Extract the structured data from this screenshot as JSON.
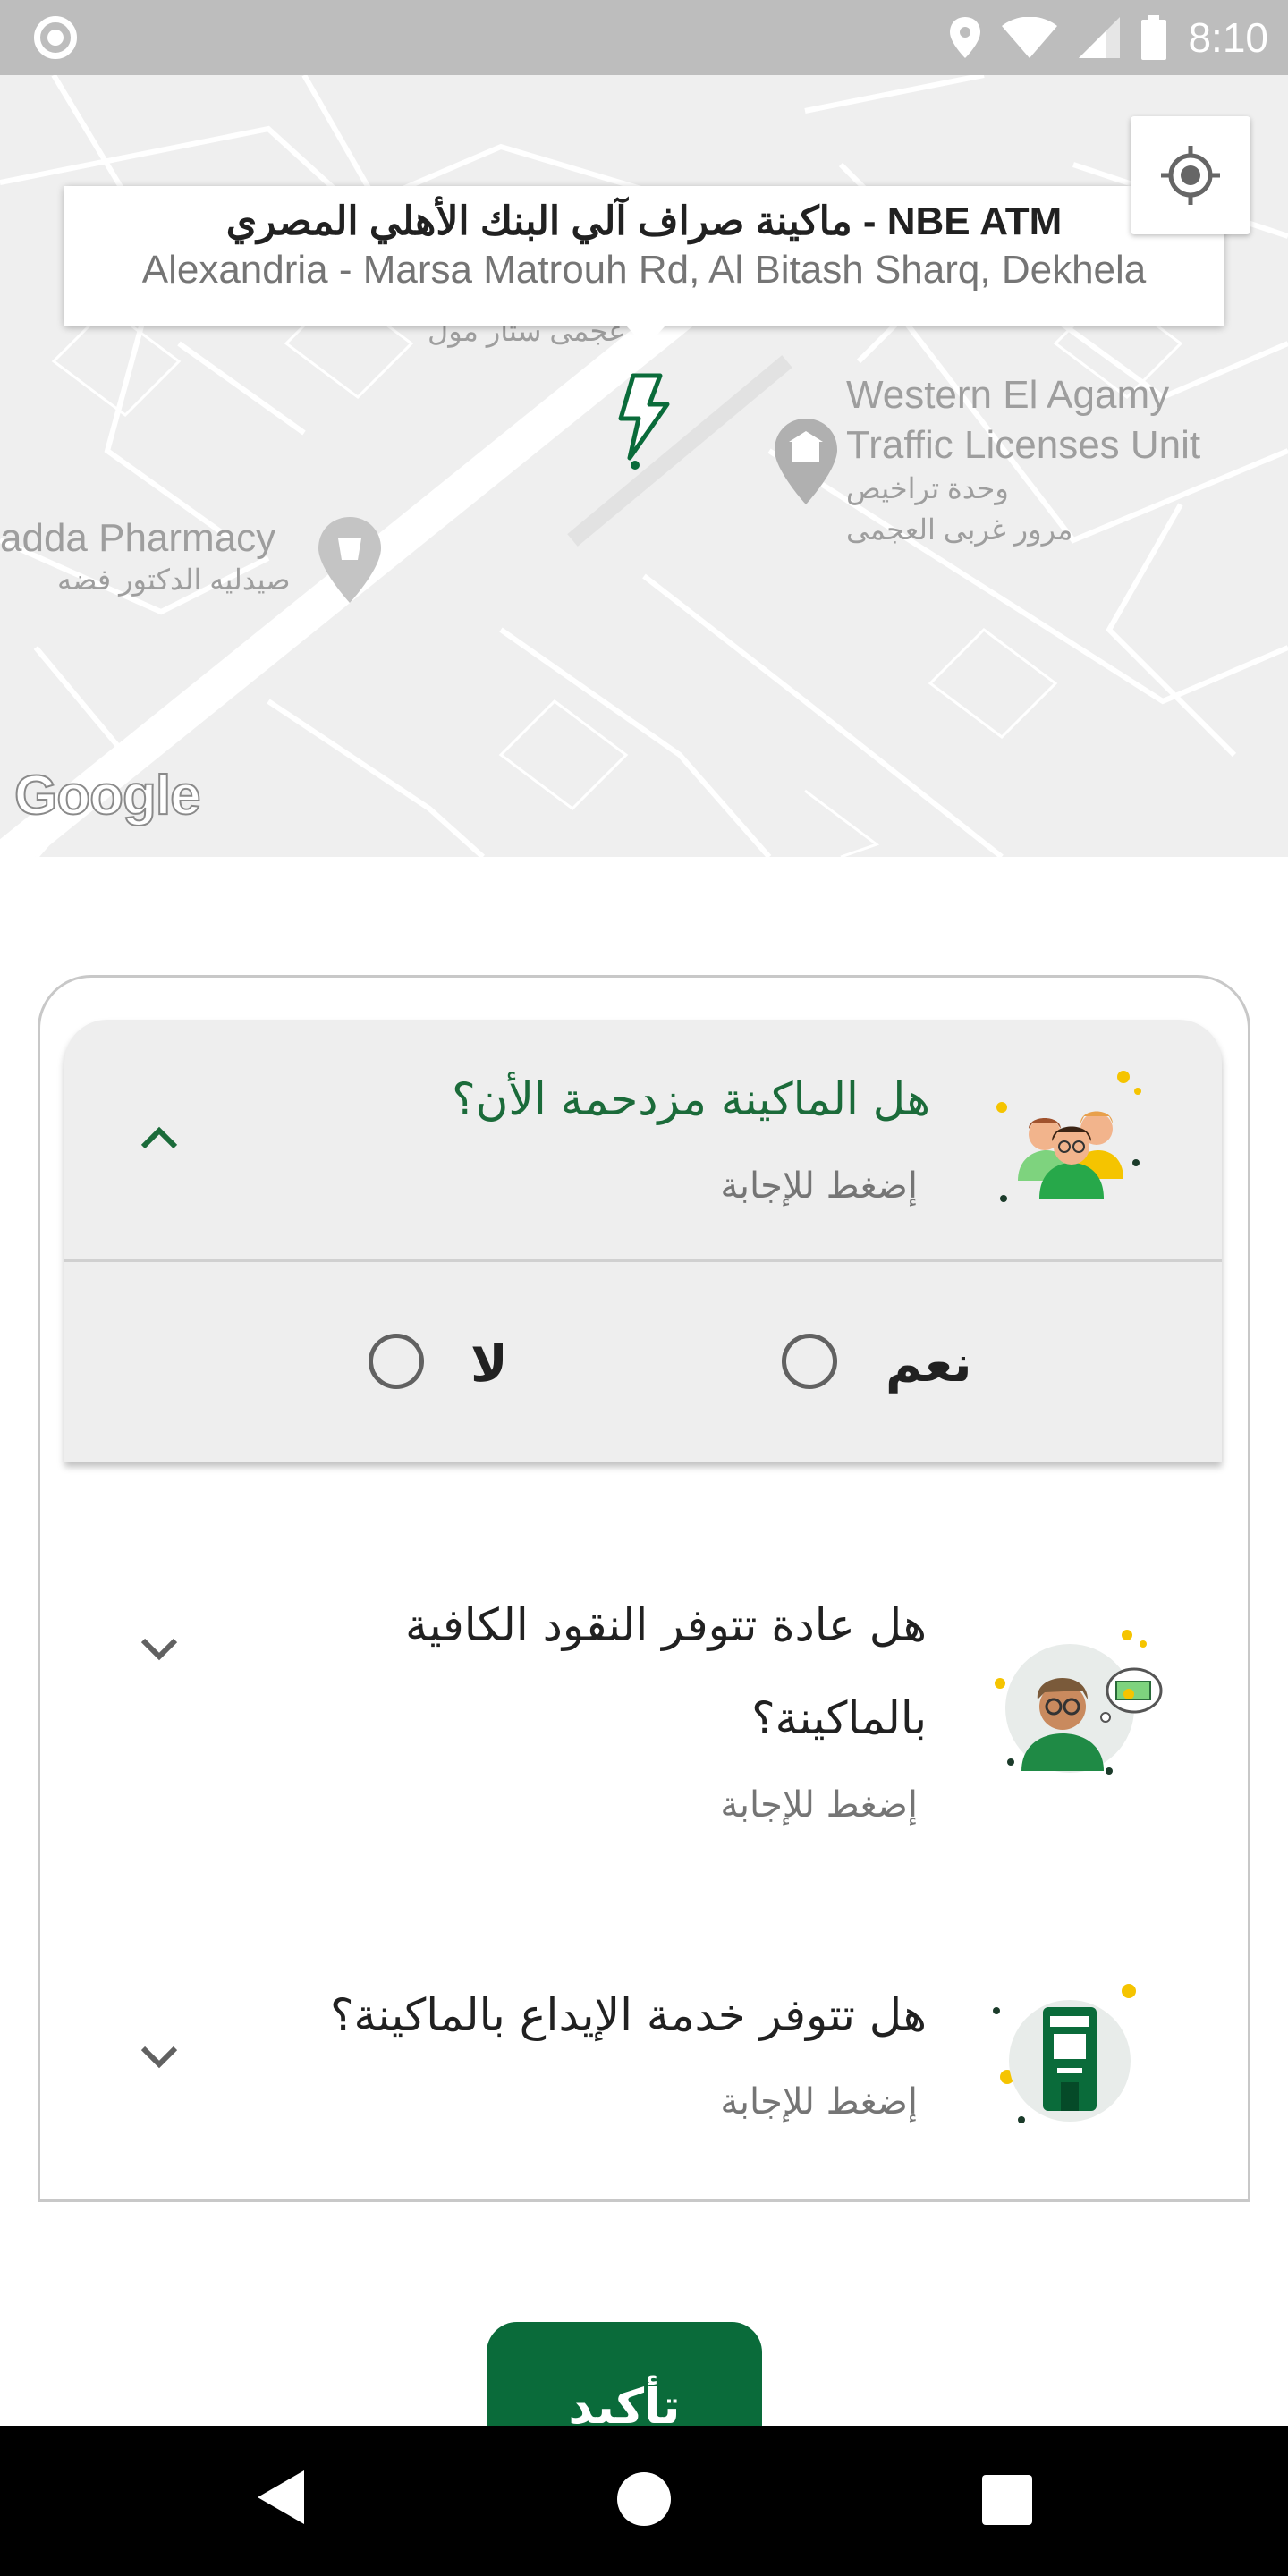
{
  "status_bar": {
    "time": "8:10",
    "icons": [
      "circle-icon",
      "location-icon",
      "wifi-icon",
      "signal-icon",
      "battery-icon"
    ]
  },
  "map": {
    "info_window": {
      "title": "ماكينة صراف آلي البنك الأهلي المصري - NBE ATM",
      "address": "Alexandria - Marsa Matrouh Rd, Al Bitash Sharq, Dekhela"
    },
    "labels": {
      "mall_ar": "عجمى ستار مول",
      "traffic_en_1": "Western El Agamy",
      "traffic_en_2": "Traffic Licenses Unit",
      "traffic_ar_1": "وحدة تراخيص",
      "traffic_ar_2": "مرور غربى العجمى",
      "pharmacy_en": "adda Pharmacy",
      "pharmacy_ar": "صيدليه الدكتور فضه"
    },
    "attribution": "Google"
  },
  "questions": [
    {
      "title": "هل الماكينة مزدحمة الأن؟",
      "hint": "إضغط للإجابة",
      "expanded": true,
      "options": {
        "yes": "نعم",
        "no": "لا"
      }
    },
    {
      "title_line1": "هل عادة تتوفر النقود الكافية",
      "title_line2": "بالماكينة؟",
      "hint": "إضغط للإجابة",
      "expanded": false
    },
    {
      "title": "هل تتوفر خدمة الإيداع بالماكينة؟",
      "hint": "إضغط للإجابة",
      "expanded": false
    }
  ],
  "confirm_label": "تأكيد",
  "colors": {
    "accent": "#0a6b3a",
    "question_green": "#1b6b3a",
    "text_dark": "#212121",
    "hint": "#757575"
  }
}
